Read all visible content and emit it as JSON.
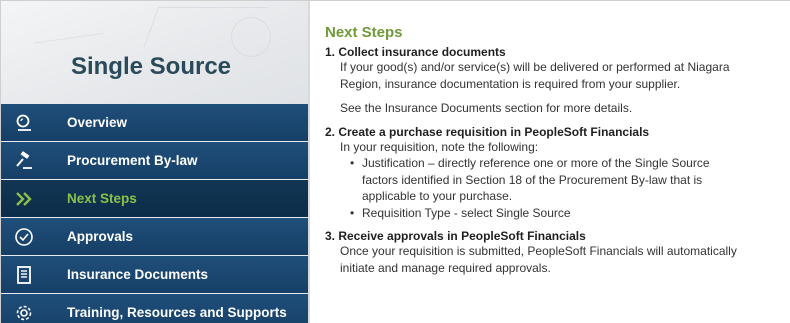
{
  "sidebar": {
    "title": "Single Source",
    "items": [
      {
        "label": "Overview",
        "icon": "magnifier-icon"
      },
      {
        "label": "Procurement By-law",
        "icon": "gavel-icon"
      },
      {
        "label": "Next Steps",
        "icon": "double-chevron-right-icon",
        "active": true
      },
      {
        "label": "Approvals",
        "icon": "check-circle-icon"
      },
      {
        "label": "Insurance Documents",
        "icon": "document-icon"
      },
      {
        "label": "Training, Resources and Supports",
        "icon": "gear-icon"
      }
    ]
  },
  "content": {
    "heading": "Next Steps",
    "step1": {
      "title": "1. Collect insurance documents",
      "line1": "If your good(s) and/or service(s) will be delivered or performed at Niagara",
      "line2": "Region, insurance documentation is required from your supplier.",
      "line3": "See the Insurance Documents section for more details."
    },
    "step2": {
      "title": "2. Create a purchase requisition in PeopleSoft Financials",
      "intro": "In your requisition, note the following:",
      "bullet1_line1": "Justification – directly reference one or more of the Single Source",
      "bullet1_line2": "factors identified in Section 18 of the Procurement By-law that is",
      "bullet1_line3": "applicable to your purchase.",
      "bullet2": "Requisition Type - select Single Source"
    },
    "step3": {
      "title": "3. Receive approvals in PeopleSoft Financials",
      "line1": "Once your requisition is submitted, PeopleSoft Financials will automatically",
      "line2": "initiate and manage required approvals."
    }
  },
  "colors": {
    "nav_bg": "#1f4f7b",
    "nav_active_bg": "#113654",
    "accent_green": "#8cc04b",
    "heading_green": "#6f9a37",
    "hero_title": "#2a4a5a"
  }
}
